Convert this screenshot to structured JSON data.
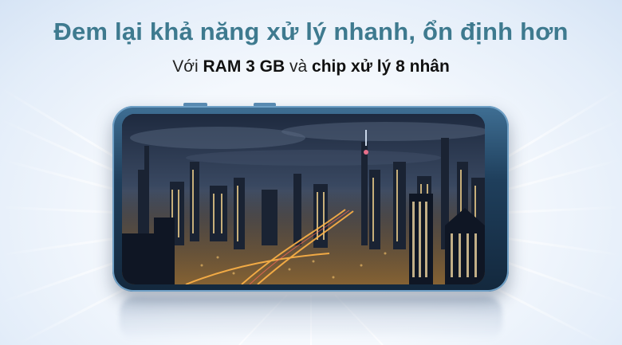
{
  "banner": {
    "headline": "Đem lại khả năng xử lý nhanh, ổn định hơn",
    "subline": {
      "prefix": "Với ",
      "ram": "RAM 3 GB",
      "middle": " và ",
      "chip": "chip xử lý 8 nhân"
    }
  },
  "colors": {
    "headline": "#3e7a8f",
    "phone_frame": "#1f3f5c",
    "background": "#e3edf9"
  }
}
